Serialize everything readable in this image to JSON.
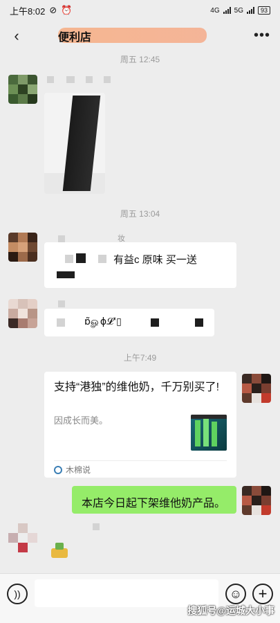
{
  "status_bar": {
    "time": "上午8:02",
    "network_1": "4G",
    "network_2": "5G",
    "battery": "93"
  },
  "nav": {
    "title": "便利店",
    "more": "•••"
  },
  "timestamps": [
    "周五 12:45",
    "周五 13:04",
    "上午7:49"
  ],
  "messages": {
    "m2_text": "有益c 原味 买一送",
    "m2_name_fragment": "妆",
    "m3_text": "ɒ̃ௐɸ𝓛'▯"
  },
  "link_card": {
    "title": "支持“港独”的维他奶，千万别买了!",
    "description": "因成长而美。",
    "source": "木棉说"
  },
  "outgoing": {
    "text": "本店今日起下架维他奶产品。"
  },
  "input_bar": {
    "placeholder": ""
  },
  "watermark": "搜狐号@运城大小事"
}
